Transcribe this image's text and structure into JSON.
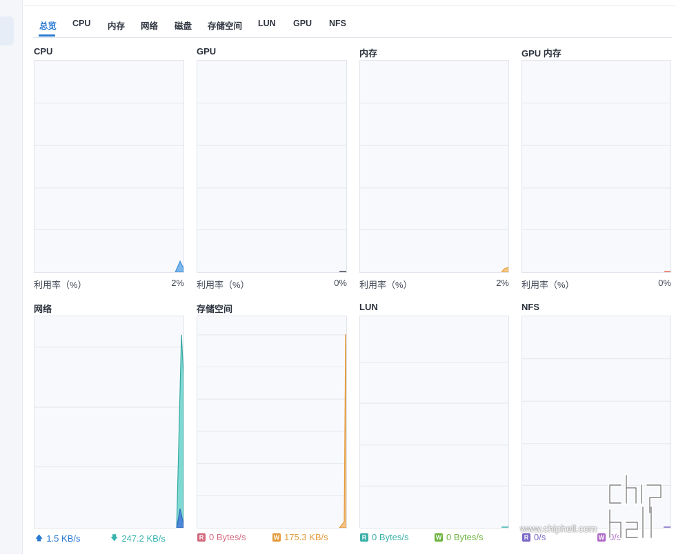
{
  "tabs": [
    "总览",
    "CPU",
    "内存",
    "网络",
    "磁盘",
    "存储空间",
    "LUN",
    "GPU",
    "NFS"
  ],
  "panels": {
    "cpu": {
      "title": "CPU",
      "footer_label": "利用率（%）",
      "value": "2%"
    },
    "gpu": {
      "title": "GPU",
      "footer_label": "利用率（%）",
      "value": "0%"
    },
    "memory": {
      "title": "内存",
      "footer_label": "利用率（%）",
      "value": "2%"
    },
    "gpu_memory": {
      "title": "GPU 内存",
      "footer_label": "利用率（%）",
      "value": "0%"
    },
    "network": {
      "title": "网络",
      "upload": "1.5 KB/s",
      "download": "247.2 KB/s"
    },
    "volume": {
      "title": "存储空间",
      "read_badge": "R",
      "read": "0 Bytes/s",
      "write_badge": "W",
      "write": "175.3 KB/s"
    },
    "lun": {
      "title": "LUN",
      "read_badge": "R",
      "read": "0 Bytes/s",
      "write_badge": "W",
      "write": "0 Bytes/s"
    },
    "nfs": {
      "title": "NFS",
      "read_badge": "R",
      "read": "0/s",
      "write_badge": "W",
      "write": "0/s"
    }
  },
  "colors": {
    "accent": "#2a79d3",
    "cpu": "#3d8fd9",
    "memory": "#e9a13b",
    "gpu_memory": "#e46b53",
    "network_up": "#2a79d3",
    "network_down": "#36b3ad",
    "volume_read": "#d46a7e",
    "volume_write": "#e39a3c",
    "lun_read": "#3ab0a8",
    "lun_write": "#6cb33f",
    "nfs_read": "#7b66c6",
    "nfs_write": "#b06cc8"
  },
  "watermark": "www.chiphell.com",
  "logo_text": "chip hell"
}
